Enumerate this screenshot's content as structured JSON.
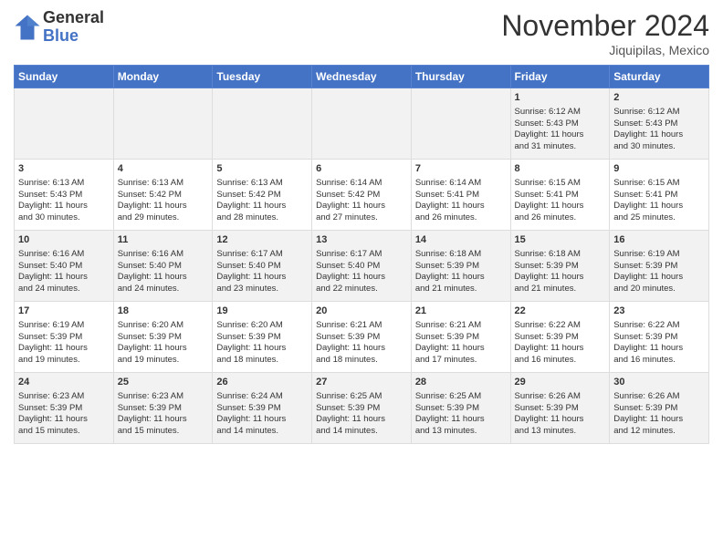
{
  "header": {
    "logo_line1": "General",
    "logo_line2": "Blue",
    "month_title": "November 2024",
    "location": "Jiquipilas, Mexico"
  },
  "days_of_week": [
    "Sunday",
    "Monday",
    "Tuesday",
    "Wednesday",
    "Thursday",
    "Friday",
    "Saturday"
  ],
  "weeks": [
    [
      {
        "day": "",
        "info": ""
      },
      {
        "day": "",
        "info": ""
      },
      {
        "day": "",
        "info": ""
      },
      {
        "day": "",
        "info": ""
      },
      {
        "day": "",
        "info": ""
      },
      {
        "day": "1",
        "info": "Sunrise: 6:12 AM\nSunset: 5:43 PM\nDaylight: 11 hours and 31 minutes."
      },
      {
        "day": "2",
        "info": "Sunrise: 6:12 AM\nSunset: 5:43 PM\nDaylight: 11 hours and 30 minutes."
      }
    ],
    [
      {
        "day": "3",
        "info": "Sunrise: 6:13 AM\nSunset: 5:43 PM\nDaylight: 11 hours and 30 minutes."
      },
      {
        "day": "4",
        "info": "Sunrise: 6:13 AM\nSunset: 5:42 PM\nDaylight: 11 hours and 29 minutes."
      },
      {
        "day": "5",
        "info": "Sunrise: 6:13 AM\nSunset: 5:42 PM\nDaylight: 11 hours and 28 minutes."
      },
      {
        "day": "6",
        "info": "Sunrise: 6:14 AM\nSunset: 5:42 PM\nDaylight: 11 hours and 27 minutes."
      },
      {
        "day": "7",
        "info": "Sunrise: 6:14 AM\nSunset: 5:41 PM\nDaylight: 11 hours and 26 minutes."
      },
      {
        "day": "8",
        "info": "Sunrise: 6:15 AM\nSunset: 5:41 PM\nDaylight: 11 hours and 26 minutes."
      },
      {
        "day": "9",
        "info": "Sunrise: 6:15 AM\nSunset: 5:41 PM\nDaylight: 11 hours and 25 minutes."
      }
    ],
    [
      {
        "day": "10",
        "info": "Sunrise: 6:16 AM\nSunset: 5:40 PM\nDaylight: 11 hours and 24 minutes."
      },
      {
        "day": "11",
        "info": "Sunrise: 6:16 AM\nSunset: 5:40 PM\nDaylight: 11 hours and 24 minutes."
      },
      {
        "day": "12",
        "info": "Sunrise: 6:17 AM\nSunset: 5:40 PM\nDaylight: 11 hours and 23 minutes."
      },
      {
        "day": "13",
        "info": "Sunrise: 6:17 AM\nSunset: 5:40 PM\nDaylight: 11 hours and 22 minutes."
      },
      {
        "day": "14",
        "info": "Sunrise: 6:18 AM\nSunset: 5:39 PM\nDaylight: 11 hours and 21 minutes."
      },
      {
        "day": "15",
        "info": "Sunrise: 6:18 AM\nSunset: 5:39 PM\nDaylight: 11 hours and 21 minutes."
      },
      {
        "day": "16",
        "info": "Sunrise: 6:19 AM\nSunset: 5:39 PM\nDaylight: 11 hours and 20 minutes."
      }
    ],
    [
      {
        "day": "17",
        "info": "Sunrise: 6:19 AM\nSunset: 5:39 PM\nDaylight: 11 hours and 19 minutes."
      },
      {
        "day": "18",
        "info": "Sunrise: 6:20 AM\nSunset: 5:39 PM\nDaylight: 11 hours and 19 minutes."
      },
      {
        "day": "19",
        "info": "Sunrise: 6:20 AM\nSunset: 5:39 PM\nDaylight: 11 hours and 18 minutes."
      },
      {
        "day": "20",
        "info": "Sunrise: 6:21 AM\nSunset: 5:39 PM\nDaylight: 11 hours and 18 minutes."
      },
      {
        "day": "21",
        "info": "Sunrise: 6:21 AM\nSunset: 5:39 PM\nDaylight: 11 hours and 17 minutes."
      },
      {
        "day": "22",
        "info": "Sunrise: 6:22 AM\nSunset: 5:39 PM\nDaylight: 11 hours and 16 minutes."
      },
      {
        "day": "23",
        "info": "Sunrise: 6:22 AM\nSunset: 5:39 PM\nDaylight: 11 hours and 16 minutes."
      }
    ],
    [
      {
        "day": "24",
        "info": "Sunrise: 6:23 AM\nSunset: 5:39 PM\nDaylight: 11 hours and 15 minutes."
      },
      {
        "day": "25",
        "info": "Sunrise: 6:23 AM\nSunset: 5:39 PM\nDaylight: 11 hours and 15 minutes."
      },
      {
        "day": "26",
        "info": "Sunrise: 6:24 AM\nSunset: 5:39 PM\nDaylight: 11 hours and 14 minutes."
      },
      {
        "day": "27",
        "info": "Sunrise: 6:25 AM\nSunset: 5:39 PM\nDaylight: 11 hours and 14 minutes."
      },
      {
        "day": "28",
        "info": "Sunrise: 6:25 AM\nSunset: 5:39 PM\nDaylight: 11 hours and 13 minutes."
      },
      {
        "day": "29",
        "info": "Sunrise: 6:26 AM\nSunset: 5:39 PM\nDaylight: 11 hours and 13 minutes."
      },
      {
        "day": "30",
        "info": "Sunrise: 6:26 AM\nSunset: 5:39 PM\nDaylight: 11 hours and 12 minutes."
      }
    ]
  ]
}
